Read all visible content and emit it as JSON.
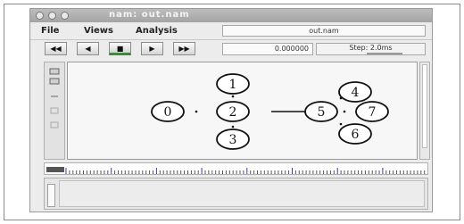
{
  "window": {
    "title": "nam: out.nam"
  },
  "menu": {
    "file": "File",
    "views": "Views",
    "analysis": "Analysis"
  },
  "trace_file": "out.nam",
  "playback": {
    "rewind_fast": "◀◀",
    "rewind": "◀",
    "stop": "■",
    "play": "▶",
    "forward_fast": "▶▶"
  },
  "time": "0.000000",
  "step": "Step: 2.0ms",
  "nodes": [
    {
      "id": "0"
    },
    {
      "id": "1"
    },
    {
      "id": "2"
    },
    {
      "id": "3"
    },
    {
      "id": "4"
    },
    {
      "id": "5"
    },
    {
      "id": "6"
    },
    {
      "id": "7"
    }
  ],
  "colors": {
    "accent": "#3d8a3d",
    "timeline_ticks": "#3a3ab0"
  }
}
